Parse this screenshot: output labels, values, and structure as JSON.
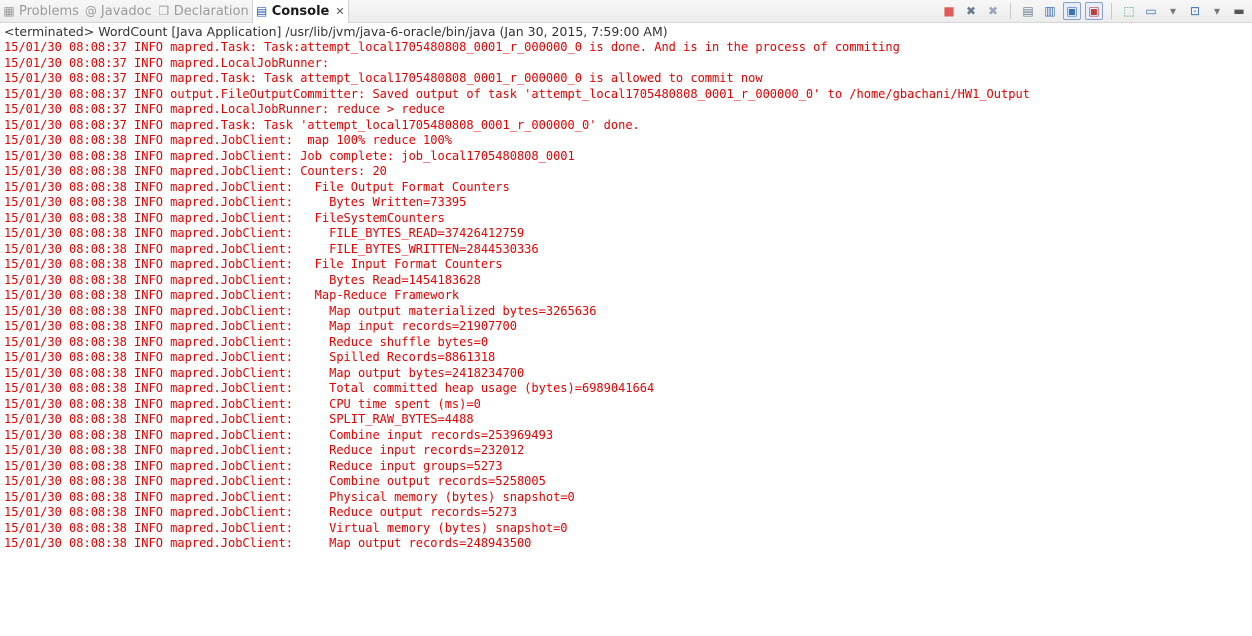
{
  "tabs": [
    {
      "label": "Problems",
      "icon": "problems-icon",
      "glyph": "▦"
    },
    {
      "label": "Javadoc",
      "icon": "javadoc-icon",
      "glyph": "@"
    },
    {
      "label": "Declaration",
      "icon": "declaration-icon",
      "glyph": "❐"
    },
    {
      "label": "Console",
      "icon": "console-icon",
      "glyph": "▤",
      "close_glyph": "✕"
    }
  ],
  "toolbar": [
    {
      "name": "terminate-icon",
      "glyph": "■",
      "color": "#e05a5a"
    },
    {
      "name": "remove-launch-icon",
      "glyph": "✖",
      "color": "#6c7a93"
    },
    {
      "name": "remove-all-terminated-icon",
      "glyph": "✖",
      "color": "#9aa6bb"
    },
    {
      "name": "sep"
    },
    {
      "name": "clear-console-icon",
      "glyph": "▤",
      "color": "#6c7a93"
    },
    {
      "name": "scroll-lock-icon",
      "glyph": "▥",
      "color": "#3d6fb6"
    },
    {
      "name": "show-stdout-icon",
      "glyph": "▣",
      "color": "#3d6fb6",
      "boxed": true
    },
    {
      "name": "show-stderr-icon",
      "glyph": "▣",
      "color": "#c04040",
      "boxed": true
    },
    {
      "name": "sep"
    },
    {
      "name": "pin-console-icon",
      "glyph": "⬚",
      "color": "#2f9e4f"
    },
    {
      "name": "display-console-icon",
      "glyph": "▭",
      "color": "#3d6fb6"
    },
    {
      "name": "display-dropdown-icon",
      "glyph": "▾",
      "color": "#777"
    },
    {
      "name": "open-console-icon",
      "glyph": "⊡",
      "color": "#3d6fb6"
    },
    {
      "name": "open-dropdown-icon",
      "glyph": "▾",
      "color": "#777"
    },
    {
      "name": "minimize-icon",
      "glyph": "▬",
      "color": "#555"
    }
  ],
  "console": {
    "header": "<terminated> WordCount [Java Application] /usr/lib/jvm/java-6-oracle/bin/java (Jan 30, 2015, 7:59:00 AM)",
    "text_color": "#e60000",
    "lines": [
      "15/01/30 08:08:37 INFO mapred.Task: Task:attempt_local1705480808_0001_r_000000_0 is done. And is in the process of commiting",
      "15/01/30 08:08:37 INFO mapred.LocalJobRunner:",
      "15/01/30 08:08:37 INFO mapred.Task: Task attempt_local1705480808_0001_r_000000_0 is allowed to commit now",
      "15/01/30 08:08:37 INFO output.FileOutputCommitter: Saved output of task 'attempt_local1705480808_0001_r_000000_0' to /home/gbachani/HW1_Output",
      "15/01/30 08:08:37 INFO mapred.LocalJobRunner: reduce > reduce",
      "15/01/30 08:08:37 INFO mapred.Task: Task 'attempt_local1705480808_0001_r_000000_0' done.",
      "15/01/30 08:08:38 INFO mapred.JobClient:  map 100% reduce 100%",
      "15/01/30 08:08:38 INFO mapred.JobClient: Job complete: job_local1705480808_0001",
      "15/01/30 08:08:38 INFO mapred.JobClient: Counters: 20",
      "15/01/30 08:08:38 INFO mapred.JobClient:   File Output Format Counters",
      "15/01/30 08:08:38 INFO mapred.JobClient:     Bytes Written=73395",
      "15/01/30 08:08:38 INFO mapred.JobClient:   FileSystemCounters",
      "15/01/30 08:08:38 INFO mapred.JobClient:     FILE_BYTES_READ=37426412759",
      "15/01/30 08:08:38 INFO mapred.JobClient:     FILE_BYTES_WRITTEN=2844530336",
      "15/01/30 08:08:38 INFO mapred.JobClient:   File Input Format Counters",
      "15/01/30 08:08:38 INFO mapred.JobClient:     Bytes Read=1454183628",
      "15/01/30 08:08:38 INFO mapred.JobClient:   Map-Reduce Framework",
      "15/01/30 08:08:38 INFO mapred.JobClient:     Map output materialized bytes=3265636",
      "15/01/30 08:08:38 INFO mapred.JobClient:     Map input records=21907700",
      "15/01/30 08:08:38 INFO mapred.JobClient:     Reduce shuffle bytes=0",
      "15/01/30 08:08:38 INFO mapred.JobClient:     Spilled Records=8861318",
      "15/01/30 08:08:38 INFO mapred.JobClient:     Map output bytes=2418234700",
      "15/01/30 08:08:38 INFO mapred.JobClient:     Total committed heap usage (bytes)=6989041664",
      "15/01/30 08:08:38 INFO mapred.JobClient:     CPU time spent (ms)=0",
      "15/01/30 08:08:38 INFO mapred.JobClient:     SPLIT_RAW_BYTES=4488",
      "15/01/30 08:08:38 INFO mapred.JobClient:     Combine input records=253969493",
      "15/01/30 08:08:38 INFO mapred.JobClient:     Reduce input records=232012",
      "15/01/30 08:08:38 INFO mapred.JobClient:     Reduce input groups=5273",
      "15/01/30 08:08:38 INFO mapred.JobClient:     Combine output records=5258005",
      "15/01/30 08:08:38 INFO mapred.JobClient:     Physical memory (bytes) snapshot=0",
      "15/01/30 08:08:38 INFO mapred.JobClient:     Reduce output records=5273",
      "15/01/30 08:08:38 INFO mapred.JobClient:     Virtual memory (bytes) snapshot=0",
      "15/01/30 08:08:38 INFO mapred.JobClient:     Map output records=248943500"
    ]
  }
}
